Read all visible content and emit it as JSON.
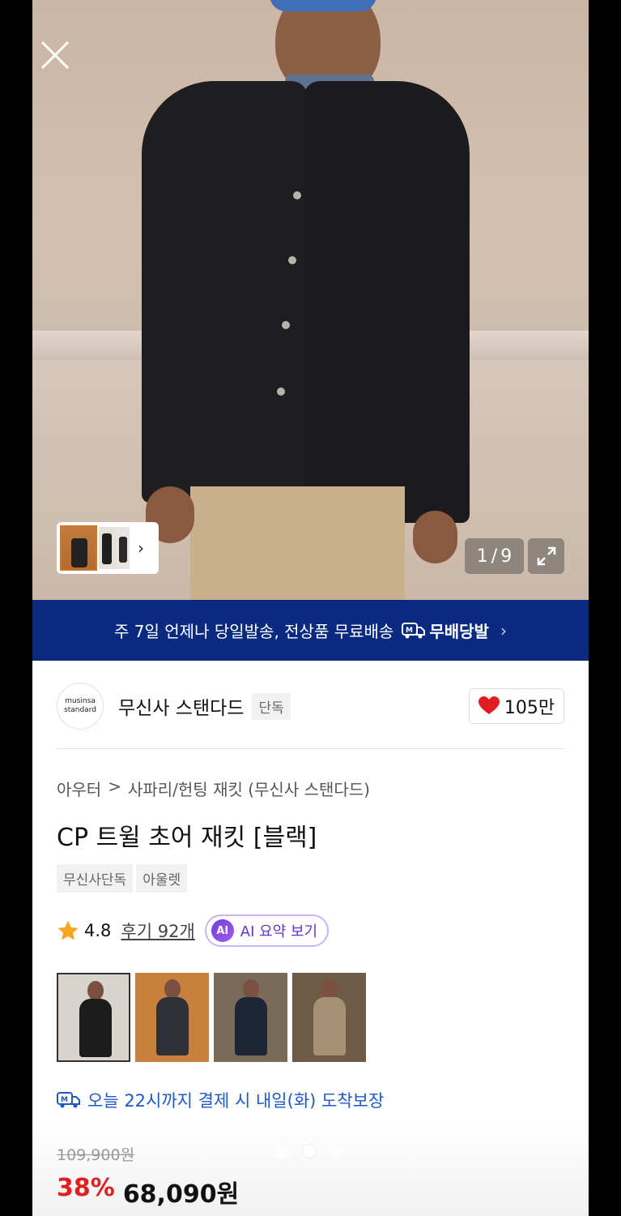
{
  "gallery": {
    "page_current": "1",
    "page_total": "9",
    "page_separator": "/"
  },
  "banner": {
    "text": "주 7일 언제나 당일발송, 전상품 무료배송",
    "brand": "무배당발",
    "chevron": "›"
  },
  "brand": {
    "logo_line1": "musinsa",
    "logo_line2": "standard",
    "name": "무신사 스탠다드",
    "badge": "단독",
    "likes": "105만"
  },
  "product": {
    "breadcrumb": [
      "아우터",
      "사파리/헌팅 재킷 (무신사 스탠다드)"
    ],
    "breadcrumb_sep": ">",
    "title": "CP 트윌 초어 재킷 [블랙]",
    "tags": [
      "무신사단독",
      "아울렛"
    ],
    "rating": "4.8",
    "reviews": "후기 92개",
    "ai_label": "AI",
    "ai_button": "AI 요약 보기"
  },
  "variants": [
    {
      "name": "black",
      "bg": "#d9d3cd",
      "color": "#1c1c1c",
      "selected": true
    },
    {
      "name": "charcoal",
      "bg": "#c9803d",
      "color": "#2f3136",
      "selected": false
    },
    {
      "name": "navy",
      "bg": "#7a6b58",
      "color": "#1d2536",
      "selected": false
    },
    {
      "name": "beige",
      "bg": "#6e5a47",
      "color": "#a89076",
      "selected": false
    }
  ],
  "delivery": {
    "text": "오늘 22시까지 결제 시 내일(화) 도착보장"
  },
  "price": {
    "original": "109,900원",
    "discount": "38%",
    "final": "68,090원"
  },
  "colors": {
    "banner_bg": "#0a2a80",
    "discount": "#e02020",
    "delivery": "#1f58c7",
    "ai_accent": "#5d36c9",
    "heart": "#e31b23"
  },
  "icons": {
    "close": "close-icon",
    "expand": "expand-icon",
    "heart": "heart-icon",
    "star": "star-icon",
    "truck": "delivery-truck-icon"
  }
}
